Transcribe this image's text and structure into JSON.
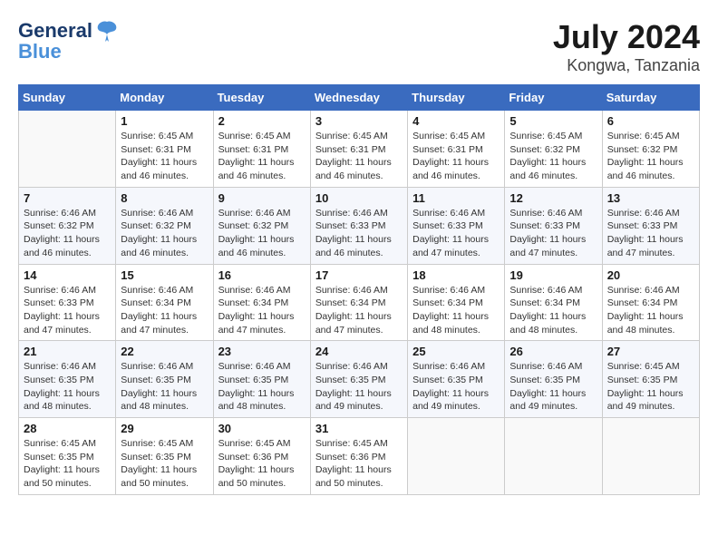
{
  "header": {
    "logo_line1": "General",
    "logo_line2": "Blue",
    "title": "July 2024",
    "subtitle": "Kongwa, Tanzania"
  },
  "calendar": {
    "days_of_week": [
      "Sunday",
      "Monday",
      "Tuesday",
      "Wednesday",
      "Thursday",
      "Friday",
      "Saturday"
    ],
    "weeks": [
      [
        {
          "day": "",
          "info": ""
        },
        {
          "day": "1",
          "info": "Sunrise: 6:45 AM\nSunset: 6:31 PM\nDaylight: 11 hours and 46 minutes."
        },
        {
          "day": "2",
          "info": "Sunrise: 6:45 AM\nSunset: 6:31 PM\nDaylight: 11 hours and 46 minutes."
        },
        {
          "day": "3",
          "info": "Sunrise: 6:45 AM\nSunset: 6:31 PM\nDaylight: 11 hours and 46 minutes."
        },
        {
          "day": "4",
          "info": "Sunrise: 6:45 AM\nSunset: 6:31 PM\nDaylight: 11 hours and 46 minutes."
        },
        {
          "day": "5",
          "info": "Sunrise: 6:45 AM\nSunset: 6:32 PM\nDaylight: 11 hours and 46 minutes."
        },
        {
          "day": "6",
          "info": "Sunrise: 6:45 AM\nSunset: 6:32 PM\nDaylight: 11 hours and 46 minutes."
        }
      ],
      [
        {
          "day": "7",
          "info": "Sunrise: 6:46 AM\nSunset: 6:32 PM\nDaylight: 11 hours and 46 minutes."
        },
        {
          "day": "8",
          "info": "Sunrise: 6:46 AM\nSunset: 6:32 PM\nDaylight: 11 hours and 46 minutes."
        },
        {
          "day": "9",
          "info": "Sunrise: 6:46 AM\nSunset: 6:32 PM\nDaylight: 11 hours and 46 minutes."
        },
        {
          "day": "10",
          "info": "Sunrise: 6:46 AM\nSunset: 6:33 PM\nDaylight: 11 hours and 46 minutes."
        },
        {
          "day": "11",
          "info": "Sunrise: 6:46 AM\nSunset: 6:33 PM\nDaylight: 11 hours and 47 minutes."
        },
        {
          "day": "12",
          "info": "Sunrise: 6:46 AM\nSunset: 6:33 PM\nDaylight: 11 hours and 47 minutes."
        },
        {
          "day": "13",
          "info": "Sunrise: 6:46 AM\nSunset: 6:33 PM\nDaylight: 11 hours and 47 minutes."
        }
      ],
      [
        {
          "day": "14",
          "info": "Sunrise: 6:46 AM\nSunset: 6:33 PM\nDaylight: 11 hours and 47 minutes."
        },
        {
          "day": "15",
          "info": "Sunrise: 6:46 AM\nSunset: 6:34 PM\nDaylight: 11 hours and 47 minutes."
        },
        {
          "day": "16",
          "info": "Sunrise: 6:46 AM\nSunset: 6:34 PM\nDaylight: 11 hours and 47 minutes."
        },
        {
          "day": "17",
          "info": "Sunrise: 6:46 AM\nSunset: 6:34 PM\nDaylight: 11 hours and 47 minutes."
        },
        {
          "day": "18",
          "info": "Sunrise: 6:46 AM\nSunset: 6:34 PM\nDaylight: 11 hours and 48 minutes."
        },
        {
          "day": "19",
          "info": "Sunrise: 6:46 AM\nSunset: 6:34 PM\nDaylight: 11 hours and 48 minutes."
        },
        {
          "day": "20",
          "info": "Sunrise: 6:46 AM\nSunset: 6:34 PM\nDaylight: 11 hours and 48 minutes."
        }
      ],
      [
        {
          "day": "21",
          "info": "Sunrise: 6:46 AM\nSunset: 6:35 PM\nDaylight: 11 hours and 48 minutes."
        },
        {
          "day": "22",
          "info": "Sunrise: 6:46 AM\nSunset: 6:35 PM\nDaylight: 11 hours and 48 minutes."
        },
        {
          "day": "23",
          "info": "Sunrise: 6:46 AM\nSunset: 6:35 PM\nDaylight: 11 hours and 48 minutes."
        },
        {
          "day": "24",
          "info": "Sunrise: 6:46 AM\nSunset: 6:35 PM\nDaylight: 11 hours and 49 minutes."
        },
        {
          "day": "25",
          "info": "Sunrise: 6:46 AM\nSunset: 6:35 PM\nDaylight: 11 hours and 49 minutes."
        },
        {
          "day": "26",
          "info": "Sunrise: 6:46 AM\nSunset: 6:35 PM\nDaylight: 11 hours and 49 minutes."
        },
        {
          "day": "27",
          "info": "Sunrise: 6:45 AM\nSunset: 6:35 PM\nDaylight: 11 hours and 49 minutes."
        }
      ],
      [
        {
          "day": "28",
          "info": "Sunrise: 6:45 AM\nSunset: 6:35 PM\nDaylight: 11 hours and 50 minutes."
        },
        {
          "day": "29",
          "info": "Sunrise: 6:45 AM\nSunset: 6:35 PM\nDaylight: 11 hours and 50 minutes."
        },
        {
          "day": "30",
          "info": "Sunrise: 6:45 AM\nSunset: 6:36 PM\nDaylight: 11 hours and 50 minutes."
        },
        {
          "day": "31",
          "info": "Sunrise: 6:45 AM\nSunset: 6:36 PM\nDaylight: 11 hours and 50 minutes."
        },
        {
          "day": "",
          "info": ""
        },
        {
          "day": "",
          "info": ""
        },
        {
          "day": "",
          "info": ""
        }
      ]
    ]
  }
}
